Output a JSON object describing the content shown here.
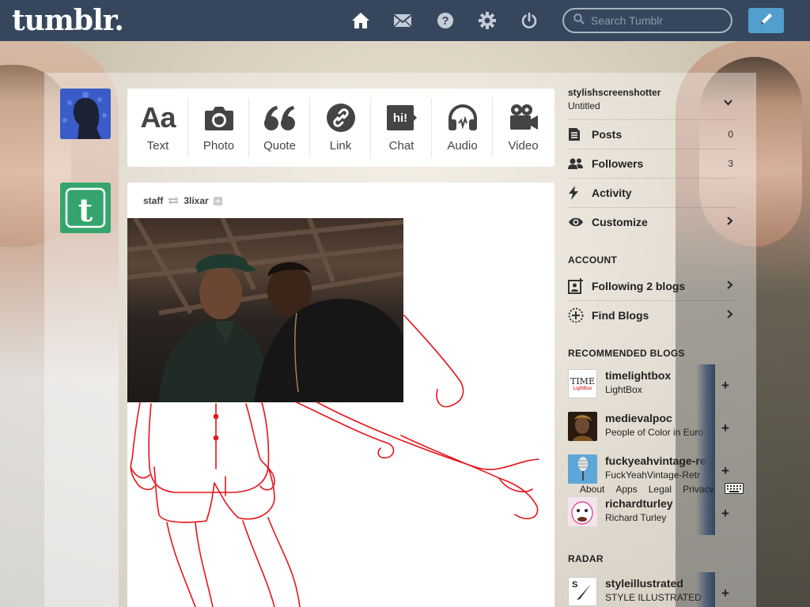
{
  "header": {
    "logo": "tumblr.",
    "search_placeholder": "Search Tumblr",
    "nav": [
      "home-icon",
      "mail-icon",
      "help-icon",
      "gear-icon",
      "power-icon"
    ],
    "compose_icon": "pencil-icon"
  },
  "post_types": [
    {
      "label": "Text",
      "icon": "Aa"
    },
    {
      "label": "Photo",
      "icon": "camera-icon"
    },
    {
      "label": "Quote",
      "icon": "quote-icon"
    },
    {
      "label": "Link",
      "icon": "link-icon"
    },
    {
      "label": "Chat",
      "icon": "chat-icon"
    },
    {
      "label": "Audio",
      "icon": "headphones-icon"
    },
    {
      "label": "Video",
      "icon": "video-camera-icon"
    }
  ],
  "post": {
    "author": "staff",
    "reblogged_from": "3lixar"
  },
  "sidebar": {
    "blog_name": "stylishscreenshotter",
    "blog_title": "Untitled",
    "items": [
      {
        "label": "Posts",
        "count": "0"
      },
      {
        "label": "Followers",
        "count": "3"
      },
      {
        "label": "Activity",
        "count": ""
      },
      {
        "label": "Customize",
        "count": ""
      }
    ],
    "account_heading": "ACCOUNT",
    "account_items": [
      {
        "label": "Following 2 blogs"
      },
      {
        "label": "Find Blogs"
      }
    ],
    "recommended_heading": "RECOMMENDED BLOGS",
    "recommended": [
      {
        "name": "timelightbox",
        "title": "LightBox",
        "avatar_text": "TIME"
      },
      {
        "name": "medievalpoc",
        "title": "People of Color in Euro"
      },
      {
        "name": "fuckyeahvintage-re",
        "title": "FuckYeahVintage-Retr"
      },
      {
        "name": "richardturley",
        "title": "Richard Turley"
      }
    ],
    "radar_heading": "RADAR",
    "radar": [
      {
        "name": "styleillustrated",
        "title": "STYLE ILLUSTRATED",
        "avatar_text": "S"
      }
    ],
    "footer_links": [
      "About",
      "Apps",
      "Legal",
      "Privacy"
    ]
  },
  "colors": {
    "header": "#36465d",
    "compose": "#529ecc",
    "drawing": "#e8141b",
    "avatar_green": "#35a56d"
  }
}
